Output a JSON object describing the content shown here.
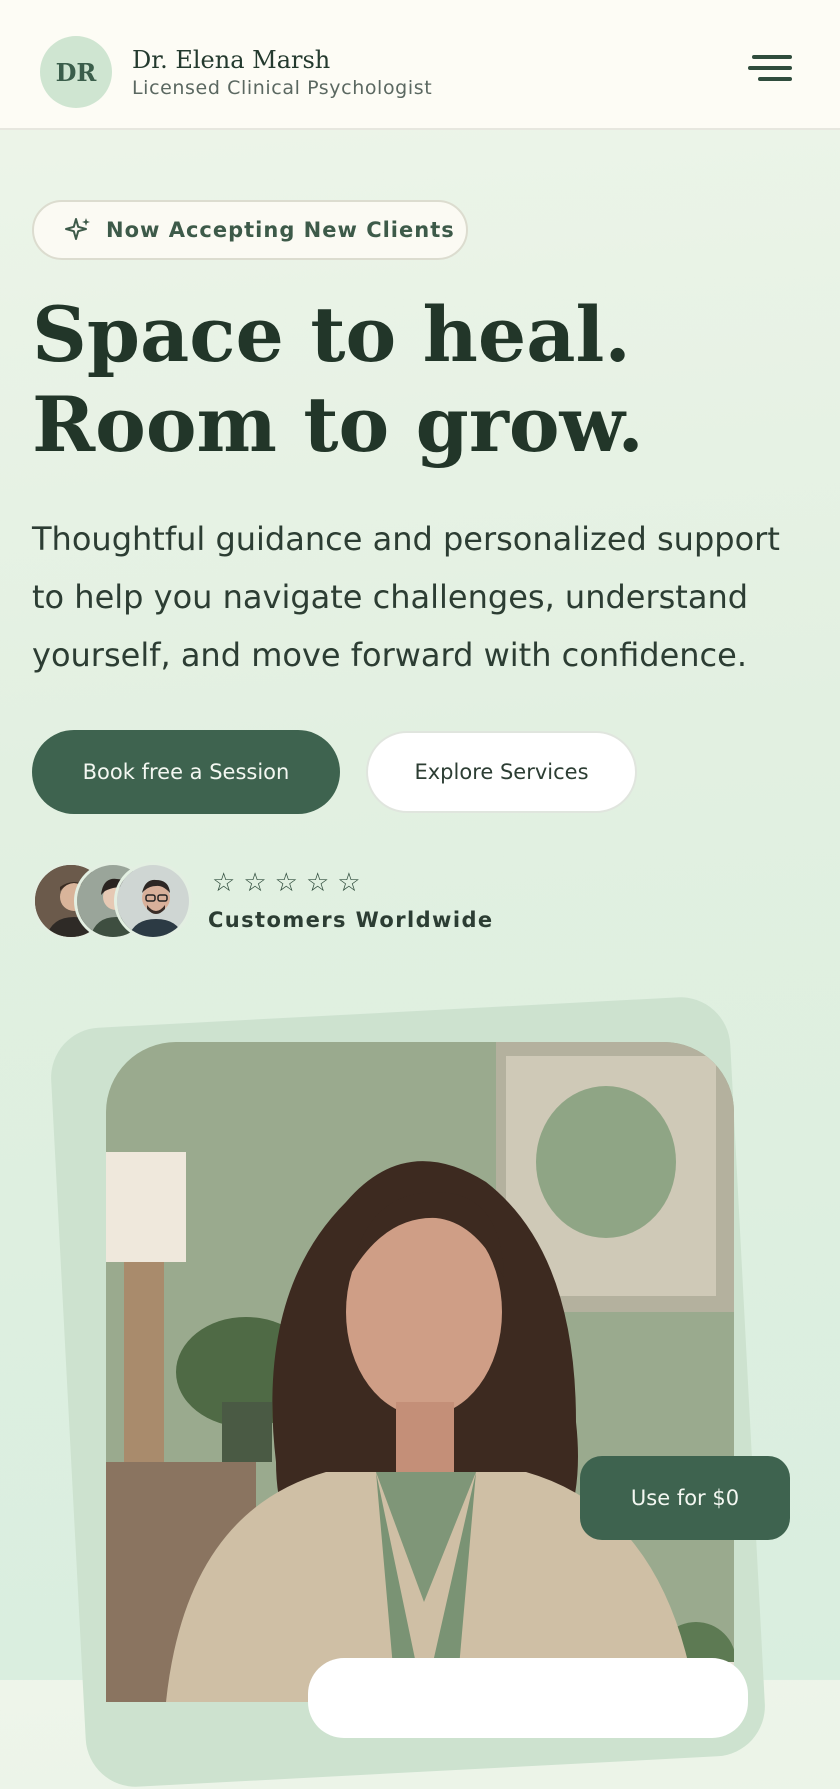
{
  "header": {
    "logo_initials": "DR",
    "name": "Dr. Elena Marsh",
    "subtitle": "Licensed Clinical Psychologist",
    "menu_icon": "hamburger-menu-icon"
  },
  "hero": {
    "badge_icon": "sparkle-icon",
    "badge_text": "Now Accepting New Clients",
    "headline_line1": "Space to heal.",
    "headline_line2": "Room to grow.",
    "description": "Thoughtful guidance and personalized support to help you navigate challenges, understand yourself, and move forward with confidence.",
    "primary_button": "Book free a Session",
    "secondary_button": "Explore Services"
  },
  "social_proof": {
    "avatars": [
      "customer-avatar-1",
      "customer-avatar-2",
      "customer-avatar-3"
    ],
    "rating_icon": "star-outline-icon",
    "stars": 5,
    "label": "Customers Worldwide"
  },
  "feature": {
    "price_button": "Use for $0"
  },
  "colors": {
    "accent": "#3e634f",
    "background": "#e2f0e1",
    "header_bg": "#fdfcf5",
    "text": "#23382c"
  }
}
